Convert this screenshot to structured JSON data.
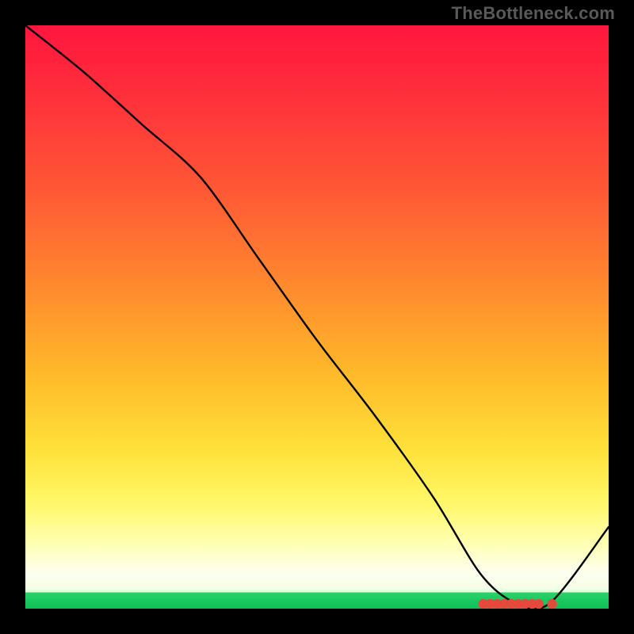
{
  "watermark": "TheBottleneck.com",
  "chart_data": {
    "type": "line",
    "title": "",
    "xlabel": "",
    "ylabel": "",
    "xlim": [
      0,
      100
    ],
    "ylim": [
      0,
      100
    ],
    "grid": false,
    "series": [
      {
        "name": "bottleneck-curve",
        "x": [
          0,
          10,
          20,
          30,
          40,
          50,
          60,
          70,
          78,
          84,
          90,
          100
        ],
        "y": [
          100,
          92,
          83,
          74,
          60,
          46,
          33,
          19,
          6,
          1,
          1,
          14
        ],
        "color": "#000000"
      }
    ],
    "markers": {
      "name": "optimal-range",
      "x": [
        78.5,
        79.7,
        80.9,
        82.1,
        83.3,
        84.5,
        85.7,
        86.9,
        88.0,
        90.3
      ],
      "y": [
        0.8,
        0.8,
        0.8,
        0.8,
        0.8,
        0.8,
        0.8,
        0.8,
        0.8,
        0.8
      ],
      "color": "#e5493b",
      "radius": 6.2
    },
    "background": {
      "type": "vertical-gradient",
      "stops": [
        {
          "pos": 0.0,
          "color": "#ff163f"
        },
        {
          "pos": 0.45,
          "color": "#ff8a2e"
        },
        {
          "pos": 0.73,
          "color": "#ffe23a"
        },
        {
          "pos": 0.94,
          "color": "#fdfff0"
        },
        {
          "pos": 0.972,
          "color": "#29d36a"
        },
        {
          "pos": 1.0,
          "color": "#0fbf57"
        }
      ]
    }
  }
}
